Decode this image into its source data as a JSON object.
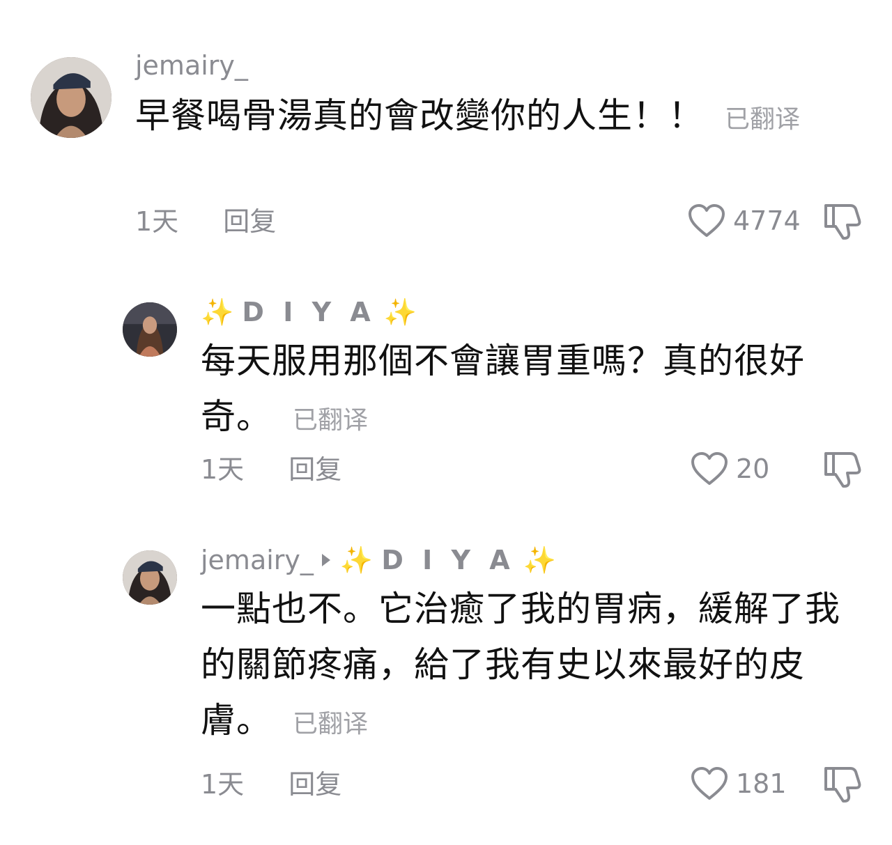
{
  "comments": [
    {
      "username": "jemairy_",
      "text": "早餐喝骨湯真的會改變你的人生！！",
      "translated_label": "已翻译",
      "time": "1天",
      "reply_label": "回复",
      "likes": "4774",
      "avatar_icon": "user-avatar-icon"
    },
    {
      "username_prefix": "✨",
      "username": "D I Y A",
      "username_suffix": "✨",
      "text": "每天服用那個不會讓胃重嗎？真的很好奇。",
      "translated_label": "已翻译",
      "time": "1天",
      "reply_label": "回复",
      "likes": "20"
    },
    {
      "username": "jemairy_",
      "reply_to_prefix": "✨",
      "reply_to": "D I Y A",
      "reply_to_suffix": "✨",
      "text": "一點也不。它治癒了我的胃病，緩解了我的關節疼痛，給了我有史以來最好的皮膚。",
      "translated_label": "已翻译",
      "time": "1天",
      "reply_label": "回复",
      "likes": "181"
    }
  ],
  "colors": {
    "muted": "#8a8b91",
    "text": "#111111",
    "sparkle": "#f2c744"
  }
}
